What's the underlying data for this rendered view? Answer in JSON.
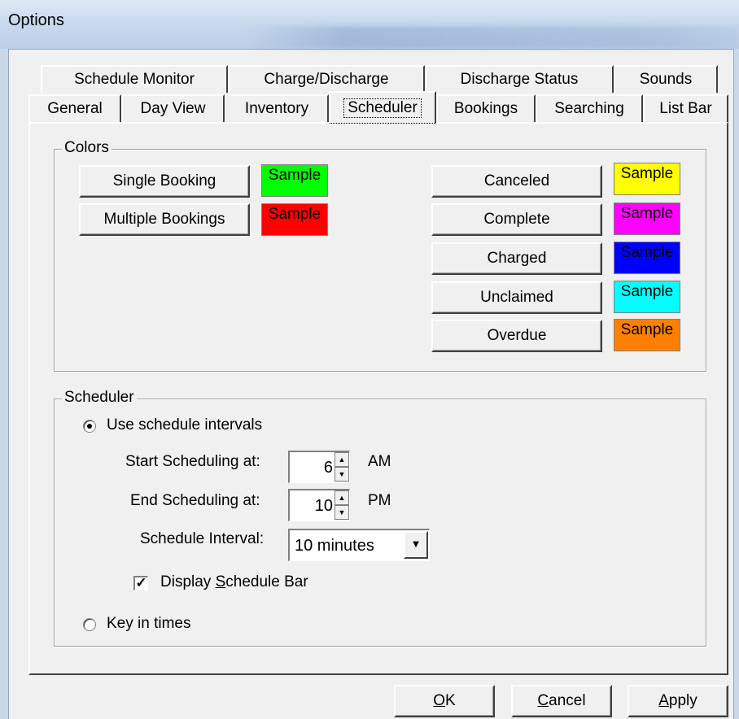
{
  "window": {
    "title": "Options"
  },
  "tabs": {
    "row1": [
      "Schedule Monitor",
      "Charge/Discharge",
      "Discharge Status",
      "Sounds"
    ],
    "row2": [
      "General",
      "Day View",
      "Inventory",
      "Scheduler",
      "Bookings",
      "Searching",
      "List Bar"
    ],
    "selected": "Scheduler"
  },
  "colors_group": {
    "label": "Colors",
    "single_booking": {
      "label": "Single Booking",
      "sample": "Sample",
      "color": "#00ff00"
    },
    "multiple_bookings": {
      "label": "Multiple Bookings",
      "sample": "Sample",
      "color": "#ff0000"
    },
    "canceled": {
      "label": "Canceled",
      "sample": "Sample",
      "color": "#ffff00"
    },
    "complete": {
      "label": "Complete",
      "sample": "Sample",
      "color": "#ff00ff"
    },
    "charged": {
      "label": "Charged",
      "sample": "Sample",
      "color": "#0000ff"
    },
    "unclaimed": {
      "label": "Unclaimed",
      "sample": "Sample",
      "color": "#00ffff"
    },
    "overdue": {
      "label": "Overdue",
      "sample": "Sample",
      "color": "#ff8000"
    }
  },
  "scheduler_group": {
    "label": "Scheduler",
    "use_intervals": {
      "label": "Use schedule intervals",
      "checked": true
    },
    "start": {
      "label": "Start Scheduling at:",
      "value": "6",
      "suffix": "AM"
    },
    "end": {
      "label": "End Scheduling at:",
      "value": "10",
      "suffix": "PM"
    },
    "interval": {
      "label": "Schedule Interval:",
      "value": "10 minutes"
    },
    "display_bar": {
      "label_pre": "Display ",
      "label_u": "S",
      "label_post": "chedule Bar",
      "checked": true
    },
    "key_in": {
      "label": "Key in times",
      "checked": false
    }
  },
  "buttons": {
    "ok": {
      "u": "O",
      "rest": "K"
    },
    "cancel": {
      "u": "C",
      "rest": "ancel"
    },
    "apply": {
      "u": "A",
      "rest": "pply"
    }
  }
}
